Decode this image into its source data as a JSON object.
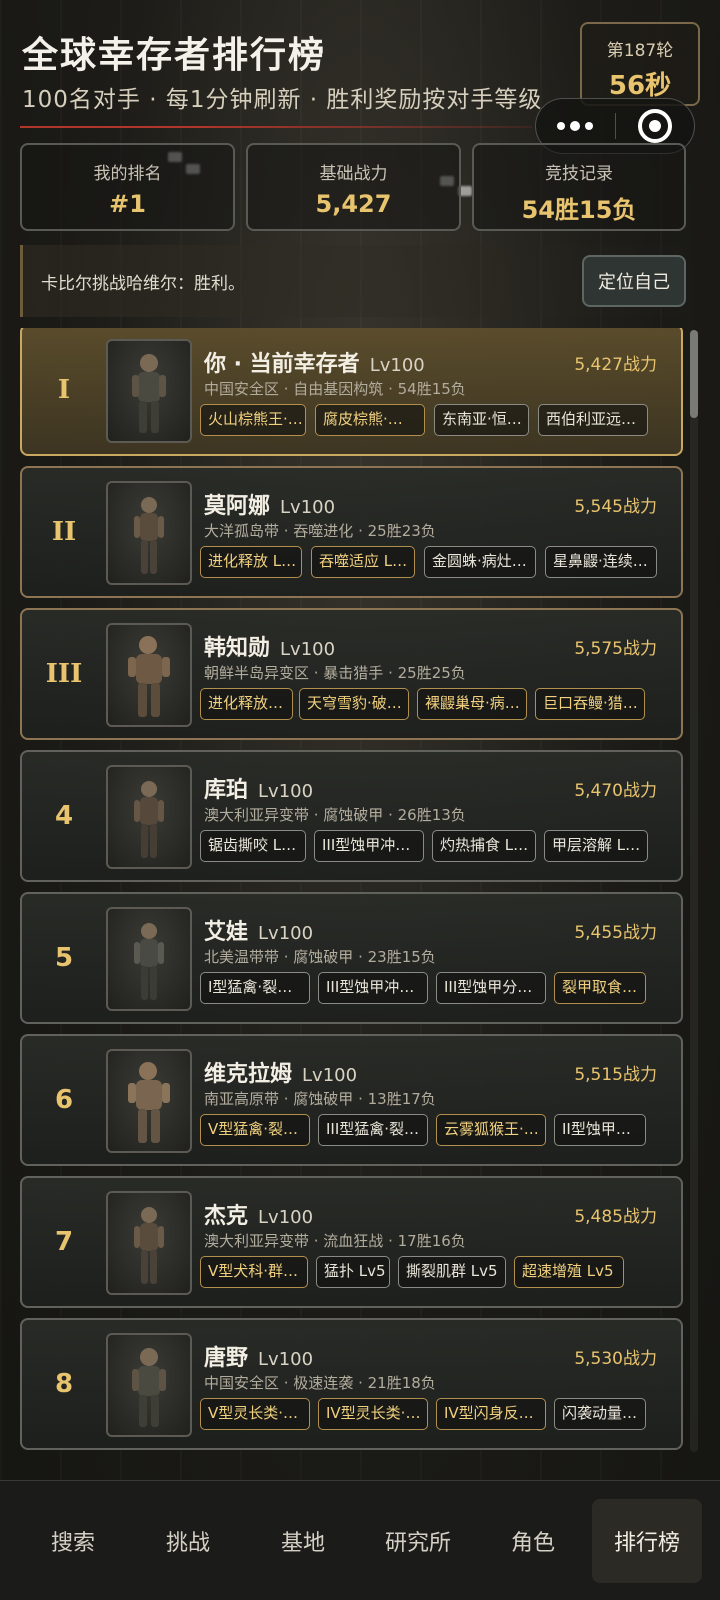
{
  "header": {
    "title": "全球幸存者排行榜",
    "subtitle": "100名对手 · 每1分钟刷新 · 胜利奖励按对手等级",
    "round_label": "第187轮",
    "round_timer": "56秒"
  },
  "stats": [
    {
      "label": "我的排名",
      "value": "#1"
    },
    {
      "label": "基础战力",
      "value": "5,427"
    },
    {
      "label": "竞技记录",
      "value": "54胜15负"
    }
  ],
  "log": {
    "text": "卡比尔挑战哈维尔：胜利。",
    "locate_label": "定位自己"
  },
  "players": [
    {
      "rank": "I",
      "name": "你 · 当前幸存者",
      "level": "Lv100",
      "power": "5,427战力",
      "info": "中国安全区 · 自由基因构筑 · 54胜15负",
      "skills": [
        "火山棕熊王·…",
        "腐皮棕熊·…",
        "东南亚·恒…",
        "西伯利亚远…"
      ]
    },
    {
      "rank": "II",
      "name": "莫阿娜",
      "level": "Lv100",
      "power": "5,545战力",
      "info": "大洋孤岛带 · 吞噬进化 · 25胜23负",
      "skills": [
        "进化释放 L…",
        "吞噬适应 L…",
        "金圆蛛·病灶…",
        "星鼻鼹·连续…"
      ]
    },
    {
      "rank": "III",
      "name": "韩知勋",
      "level": "Lv100",
      "power": "5,575战力",
      "info": "朝鲜半岛异变区 · 暴击猎手 · 25胜25负",
      "skills": [
        "进化释放…",
        "天穹雪豹·破…",
        "裸鼹巢母·病…",
        "巨口吞鳗·猎…"
      ]
    },
    {
      "rank": "4",
      "name": "库珀",
      "level": "Lv100",
      "power": "5,470战力",
      "info": "澳大利亚异变带 · 腐蚀破甲 · 26胜13负",
      "skills": [
        "锯齿撕咬 L…",
        "III型蚀甲冲…",
        "灼热捕食 L…",
        "甲层溶解 L…"
      ]
    },
    {
      "rank": "5",
      "name": "艾娃",
      "level": "Lv100",
      "power": "5,455战力",
      "info": "北美温带带 · 腐蚀破甲 · 23胜15负",
      "skills": [
        "I型猛禽·裂…",
        "III型蚀甲冲…",
        "III型蚀甲分…",
        "裂甲取食…"
      ]
    },
    {
      "rank": "6",
      "name": "维克拉姆",
      "level": "Lv100",
      "power": "5,515战力",
      "info": "南亚高原带 · 腐蚀破甲 · 13胜17负",
      "skills": [
        "V型猛禽·裂…",
        "III型猛禽·裂…",
        "云雾狐猴王·…",
        "II型蚀甲…"
      ]
    },
    {
      "rank": "7",
      "name": "杰克",
      "level": "Lv100",
      "power": "5,485战力",
      "info": "澳大利亚异变带 · 流血狂战 · 17胜16负",
      "skills": [
        "V型犬科·群…",
        "猛扑 Lv5",
        "撕裂肌群 Lv5",
        "超速增殖 Lv5"
      ]
    },
    {
      "rank": "8",
      "name": "唐野",
      "level": "Lv100",
      "power": "5,530战力",
      "info": "中国安全区 · 极速连袭 · 21胜18负",
      "skills": [
        "V型灵长类·…",
        "IV型灵长类·…",
        "IV型闪身反…",
        "闪袭动量…"
      ]
    }
  ],
  "nav": [
    "搜索",
    "挑战",
    "基地",
    "研究所",
    "角色",
    "排行榜"
  ],
  "nav_active": "排行榜",
  "colors": {
    "accent_gold": "#e8c46e",
    "current_row_bg": "#5d4e2c",
    "rule_red": "#b0362b"
  },
  "icons": [
    "more-dots-icon",
    "target-icon",
    "portrait-figure-icon"
  ]
}
